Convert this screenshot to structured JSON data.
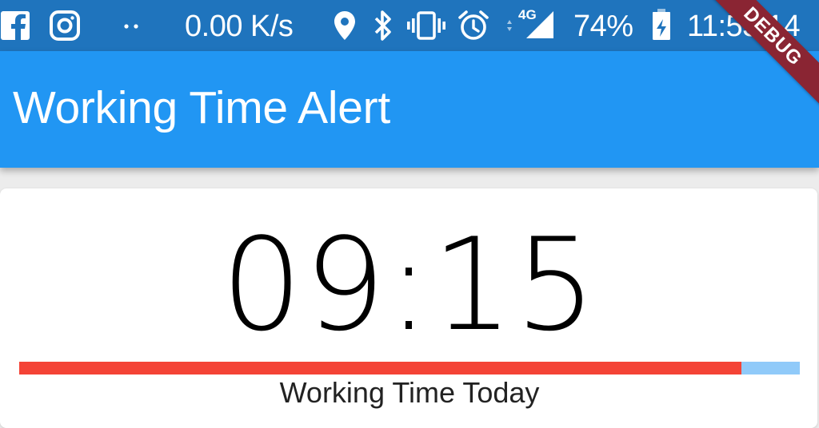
{
  "status_bar": {
    "network_speed": "0.00 K/s",
    "network_type": "4G",
    "battery": "74%",
    "time": "11:53:14",
    "icons": [
      "facebook-icon",
      "instagram-icon",
      "more-notifications-icon",
      "location-icon",
      "bluetooth-icon",
      "vibrate-icon",
      "alarm-icon",
      "signal-icon",
      "battery-icon"
    ],
    "background": "#1f74bd"
  },
  "app_bar": {
    "title": "Working Time Alert",
    "background": "#2196f3"
  },
  "debug_banner": {
    "label": "DEBUG"
  },
  "main": {
    "time_display": "09:15",
    "progress": {
      "fraction": 0.925,
      "fill_color": "#f44336",
      "track_color": "#90caf9"
    },
    "subtitle": "Working Time Today"
  }
}
